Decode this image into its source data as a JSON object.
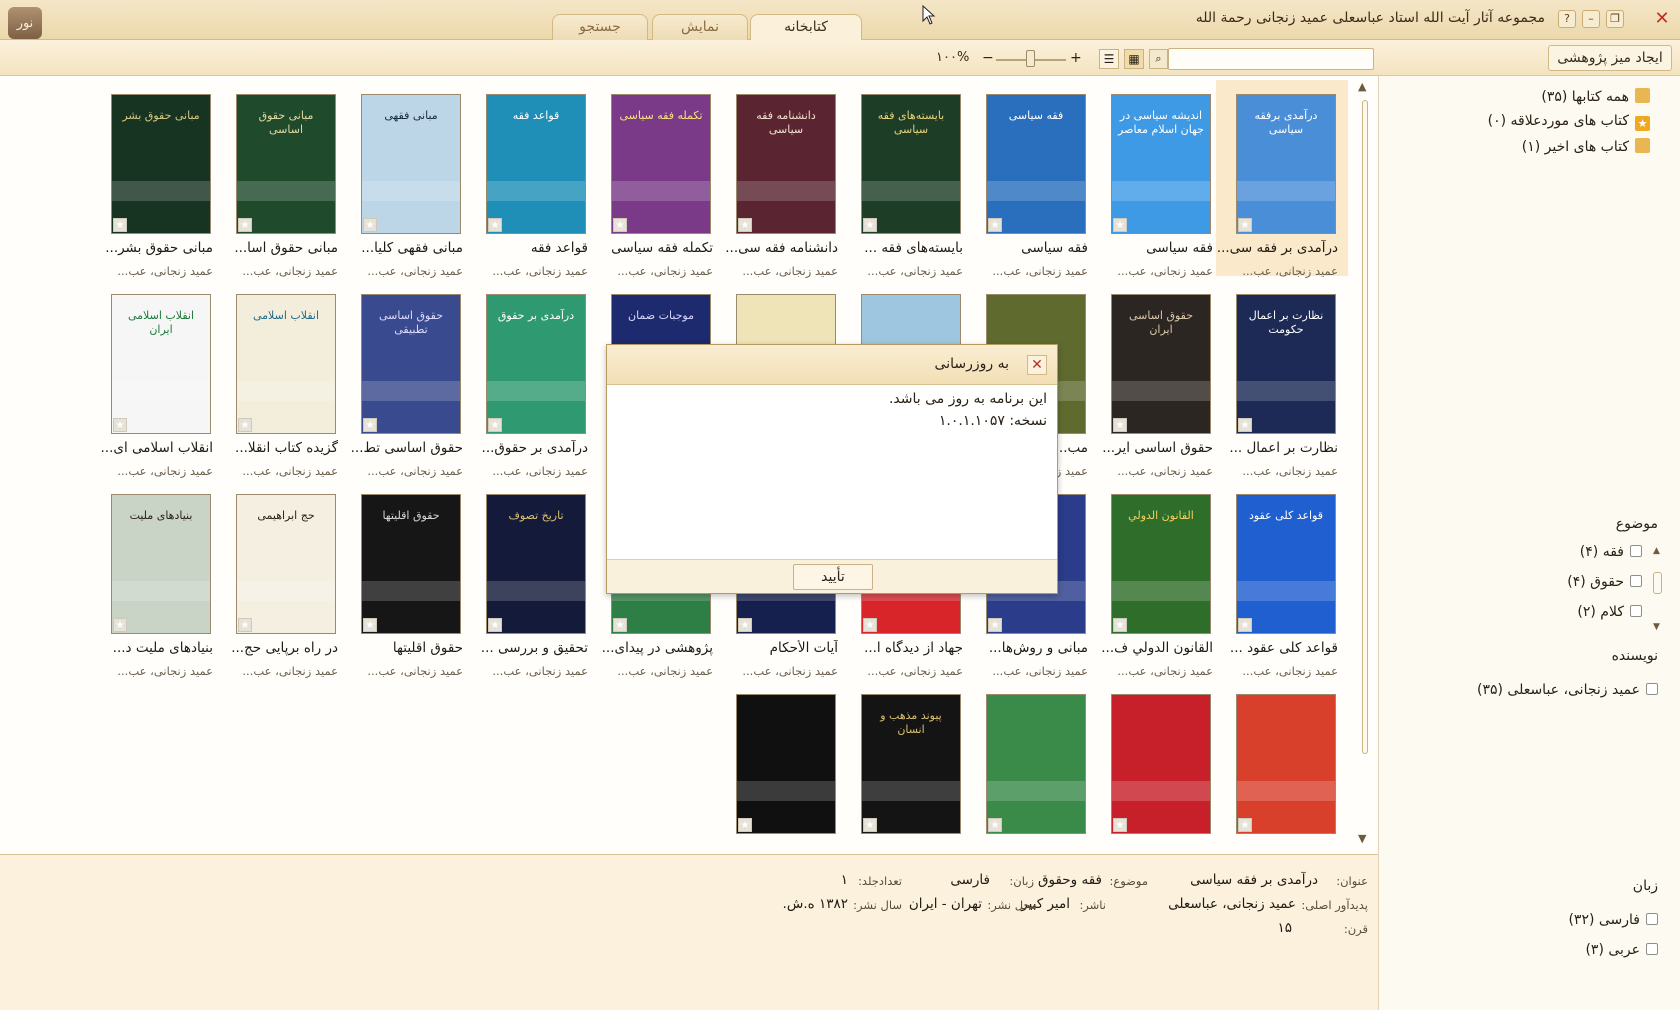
{
  "window": {
    "title": "مجموعه آثار آیت الله استاد عباسعلی عمید زنجانی رحمة الله",
    "logo_text": "نور",
    "tabs": [
      {
        "label": "کتابخانه",
        "active": true
      },
      {
        "label": "نمایش",
        "active": false
      },
      {
        "label": "جستجو",
        "active": false
      }
    ]
  },
  "toolbar": {
    "new_desk_label": "ایجاد میز پژوهشی",
    "search_value": "",
    "zoom_label": "۱۰۰%"
  },
  "books": [
    {
      "title": "درآمدی بر فقه سی...",
      "author": "عمید زنجانی، عب...",
      "cover_text": "درآمدی برفقه سیاسی",
      "bg": "#4a8ed8",
      "fg": "#ffffff",
      "selected": true
    },
    {
      "title": "فقه سیاسی",
      "author": "عمید زنجانی، عب...",
      "cover_text": "اندیشه سیاسی در جهان اسلام معاصر",
      "bg": "#3f9ae6",
      "fg": "#ffffff",
      "selected": false
    },
    {
      "title": "فقه سیاسی",
      "author": "عمید زنجانی، عب...",
      "cover_text": "فقه سیاسی",
      "bg": "#2a6fbd",
      "fg": "#ffffff",
      "selected": false
    },
    {
      "title": "بایسته‌های فقه ...",
      "author": "عمید زنجانی، عب...",
      "cover_text": "بایسته‌های فقه سیاسی",
      "bg": "#1d3d26",
      "fg": "#e8d27a",
      "selected": false
    },
    {
      "title": "دانشنامه فقه سی...",
      "author": "عمید زنجانی، عب...",
      "cover_text": "دانشنامه فقه سیاسی",
      "bg": "#5a2430",
      "fg": "#f1e2d0",
      "selected": false
    },
    {
      "title": "تکمله فقه سیاسی",
      "author": "عمید زنجانی، عب...",
      "cover_text": "تکمله فقه سیاسی",
      "bg": "#7b3a88",
      "fg": "#f7e27a",
      "selected": false
    },
    {
      "title": "قواعد فقه",
      "author": "عمید زنجانی، عب...",
      "cover_text": "قواعد فقه",
      "bg": "#1f8fb8",
      "fg": "#ffffff",
      "selected": false
    },
    {
      "title": "مبانی فقهی کلیا...",
      "author": "عمید زنجانی، عب...",
      "cover_text": "مبانی فقهی",
      "bg": "#bcd6e8",
      "fg": "#1a2a3a",
      "selected": false
    },
    {
      "title": "مبانی حقوق اسا...",
      "author": "عمید زنجانی، عب...",
      "cover_text": "مبانی حقوق اساسی",
      "bg": "#1f4a2c",
      "fg": "#e6d9a0",
      "selected": false
    },
    {
      "title": "مبانی حقوق بشر...",
      "author": "عمید زنجانی، عب...",
      "cover_text": "مبانی حقوق بشر",
      "bg": "#173321",
      "fg": "#d9c884",
      "selected": false
    },
    {
      "title": "نظارت بر اعمال ...",
      "author": "عمید زنجانی، عب...",
      "cover_text": "نظارت بر اعمال حکومت",
      "bg": "#1c2a55",
      "fg": "#ffffff",
      "selected": false
    },
    {
      "title": "حقوق اساسی ایر...",
      "author": "عمید زنجانی، عب...",
      "cover_text": "حقوق اساسی ایران",
      "bg": "#2c2622",
      "fg": "#d8c8a8",
      "selected": false
    },
    {
      "title": "مب...",
      "author": "عمید زنجانی، عب...",
      "cover_text": "",
      "bg": "#5f6b2e",
      "fg": "#ffffff",
      "selected": false
    },
    {
      "title": "",
      "author": "عمید زنجانی، عب...",
      "cover_text": "",
      "bg": "#9fc6e0",
      "fg": "#1a2a3a",
      "selected": false
    },
    {
      "title": "",
      "author": "عمید زنجانی، عب...",
      "cover_text": "",
      "bg": "#efe4b8",
      "fg": "#3a2c18",
      "selected": false
    },
    {
      "title": "...مان",
      "author": "عمید زنجانی، عب...",
      "cover_text": "موجبات ضمان",
      "bg": "#1e2a6e",
      "fg": "#d8d8ff",
      "selected": false
    },
    {
      "title": "درآمدی بر حقوق...",
      "author": "عمید زنجانی، عب...",
      "cover_text": "درآمدی بر حقوق",
      "bg": "#2f9a72",
      "fg": "#ffffff",
      "selected": false
    },
    {
      "title": "حقوق اساسی تط...",
      "author": "عمید زنجانی، عب...",
      "cover_text": "حقوق اساسی تطبیقی",
      "bg": "#3a4a8e",
      "fg": "#dcdcff",
      "selected": false
    },
    {
      "title": "گزیده کتاب انقلا...",
      "author": "عمید زنجانی، عب...",
      "cover_text": "انقلاب اسلامی",
      "bg": "#f3eedc",
      "fg": "#1f6a8a",
      "selected": false
    },
    {
      "title": "انقلاب اسلامی ای...",
      "author": "عمید زنجانی، عب...",
      "cover_text": "انقلاب اسلامی ایران",
      "bg": "#f6f6f6",
      "fg": "#1c7a3c",
      "selected": false
    },
    {
      "title": "قواعد کلی عقود ...",
      "author": "عمید زنجانی، عب...",
      "cover_text": "قواعد کلی عقود",
      "bg": "#1f5fcf",
      "fg": "#ffffff",
      "selected": false
    },
    {
      "title": "القانون الدولي ف...",
      "author": "عمید زنجانی، عب...",
      "cover_text": "القانون الدولي",
      "bg": "#2f6e2a",
      "fg": "#f0d060",
      "selected": false
    },
    {
      "title": "مبانی و روش‌ها...",
      "author": "عمید زنجانی، عب...",
      "cover_text": "",
      "bg": "#2a3c8a",
      "fg": "#f0d080",
      "selected": false
    },
    {
      "title": "جهاد از دیدگاه ا...",
      "author": "عمید زنجانی، عب...",
      "cover_text": "",
      "bg": "#d8252a",
      "fg": "#ffffff",
      "selected": false
    },
    {
      "title": "آیات الأحکام",
      "author": "عمید زنجانی، عب...",
      "cover_text": "",
      "bg": "#16204f",
      "fg": "#ffffff",
      "selected": false
    },
    {
      "title": "پژوهشی در پیدای...",
      "author": "عمید زنجانی، عب...",
      "cover_text": "",
      "bg": "#2e7f46",
      "fg": "#ffffff",
      "selected": false
    },
    {
      "title": "تحقیق و بررسی ...",
      "author": "عمید زنجانی، عب...",
      "cover_text": "تاریخ تصوف",
      "bg": "#141a3a",
      "fg": "#d9c070",
      "selected": false
    },
    {
      "title": "حقوق اقلیتها",
      "author": "عمید زنجانی، عب...",
      "cover_text": "حقوق اقلیتها",
      "bg": "#161616",
      "fg": "#d8d8d8",
      "selected": false
    },
    {
      "title": "در راه برپایی حج...",
      "author": "عمید زنجانی، عب...",
      "cover_text": "حج ابراهیمی",
      "bg": "#f5efe2",
      "fg": "#2a2116",
      "selected": false
    },
    {
      "title": "بنیادهای ملیت د...",
      "author": "عمید زنجانی، عب...",
      "cover_text": "بنیادهای ملیت",
      "bg": "#c9d3c6",
      "fg": "#2a2116",
      "selected": false
    },
    {
      "title": "",
      "author": "",
      "cover_text": "",
      "bg": "#d8402c",
      "fg": "#ffffff",
      "selected": false
    },
    {
      "title": "",
      "author": "",
      "cover_text": "",
      "bg": "#c8202a",
      "fg": "#ffffff",
      "selected": false
    },
    {
      "title": "",
      "author": "",
      "cover_text": "",
      "bg": "#3a8a4a",
      "fg": "#ffffff",
      "selected": false
    },
    {
      "title": "",
      "author": "",
      "cover_text": "پیوند مذهب و انسان",
      "bg": "#141414",
      "fg": "#d9c070",
      "selected": false
    },
    {
      "title": "",
      "author": "",
      "cover_text": "",
      "bg": "#101010",
      "fg": "#ffffff",
      "selected": false
    }
  ],
  "sidebar": {
    "tree": [
      {
        "label": "همه کتابها (۳۵)",
        "icon": "books-icon",
        "color": "#e8b652"
      },
      {
        "label": "کتاب های موردعلاقه (۰)",
        "icon": "star-icon",
        "color": "#f0a820"
      },
      {
        "label": "کتاب های اخیر (۱)",
        "icon": "recent-books-icon",
        "color": "#e8b652"
      }
    ],
    "subject": {
      "heading": "موضوع",
      "items": [
        {
          "label": "فقه (۴)"
        },
        {
          "label": "حقوق (۴)"
        },
        {
          "label": "کلام (۲)"
        }
      ]
    },
    "author": {
      "heading": "نویسنده",
      "items": [
        {
          "label": "عمید زنجانی، عباسعلی (۳۵)"
        }
      ]
    },
    "language": {
      "heading": "زبان",
      "items": [
        {
          "label": "فارسی (۳۲)"
        },
        {
          "label": "عربی (۳)"
        }
      ]
    }
  },
  "details": {
    "title_label": "عنوان:",
    "title_value": "درآمدی بر فقه سیاسی",
    "subject_label": "موضوع:",
    "subject_value": "فقه وحقوق",
    "language_label": "زبان:",
    "language_value": "فارسی",
    "volumes_label": "تعدادجلد:",
    "volumes_value": "۱",
    "creator_label": "پدیدآور اصلی:",
    "creator_value": "عمید زنجانی، عباسعلی",
    "publisher_label": "ناشر:",
    "publisher_value": "امیر کبیر",
    "place_label": "محل نشر:",
    "place_value": "تهران - ایران",
    "year_label": "سال نشر:",
    "year_value": "۱۳۸۲ ه.ش.",
    "century_label": "قرن:",
    "century_value": "۱۵"
  },
  "dialog": {
    "title": "به روزرسانی",
    "message": "این برنامه به روز می باشد.",
    "version": "نسخه: ۱.۰.۱.۱۰۵۷",
    "ok_label": "تأیید"
  }
}
